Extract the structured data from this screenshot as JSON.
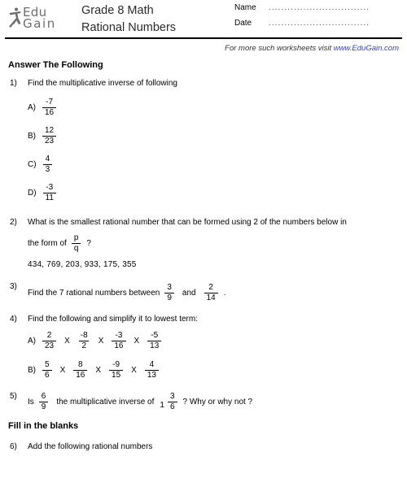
{
  "header": {
    "logo": {
      "icon": "running-figure-icon",
      "line1": "Edu",
      "line2": "Gain"
    },
    "title_line1": "Grade 8 Math",
    "title_line2": "Rational Numbers",
    "name_label": "Name",
    "date_label": "Date",
    "name_value": "",
    "date_value": "",
    "dots": "................................"
  },
  "promo": {
    "text": "For more such worksheets visit ",
    "link": "www.EduGain.com",
    "link_color": "#2c3fd6"
  },
  "sections": [
    {
      "heading": "Answer The Following"
    },
    {
      "heading": "Fill in the blanks"
    }
  ],
  "questions": {
    "q1": {
      "number": "1)",
      "text": "Find the multiplicative inverse of following",
      "options": [
        {
          "label": "A)",
          "num": "-7",
          "den": "16"
        },
        {
          "label": "B)",
          "num": "12",
          "den": "23"
        },
        {
          "label": "C)",
          "num": "4",
          "den": "3"
        },
        {
          "label": "D)",
          "num": "-3",
          "den": "11"
        }
      ]
    },
    "q2": {
      "number": "2)",
      "line1": "What is the smallest rational number that can be formed using 2 of the numbers below in",
      "line2_lead": "the form of",
      "frac_num": "p",
      "frac_den": "q",
      "line2_tail": "?",
      "numbers": "434, 769, 203, 933, 175, 355"
    },
    "q3": {
      "number": "3)",
      "lead": "Find the 7 rational numbers between",
      "frac1_num": "3",
      "frac1_den": "9",
      "mid": "and",
      "frac2_num": "2",
      "frac2_den": "14",
      "tail": "."
    },
    "q4": {
      "number": "4)",
      "text": "Find the following and simplify it to lowest term:",
      "operator": "X",
      "options": [
        {
          "label": "A)",
          "fractions": [
            {
              "num": "2",
              "den": "23"
            },
            {
              "num": "-8",
              "den": "2"
            },
            {
              "num": "-3",
              "den": "16"
            },
            {
              "num": "-5",
              "den": "13"
            }
          ]
        },
        {
          "label": "B)",
          "fractions": [
            {
              "num": "5",
              "den": "6"
            },
            {
              "num": "8",
              "den": "16"
            },
            {
              "num": "-9",
              "den": "15"
            },
            {
              "num": "4",
              "den": "13"
            }
          ]
        }
      ]
    },
    "q5": {
      "number": "5)",
      "lead": "Is",
      "frac1_num": "6",
      "frac1_den": "9",
      "mid": "the multiplicative inverse of",
      "mixed_whole": "1",
      "mixed_num": "3",
      "mixed_den": "6",
      "tail": "? Why or why not ?"
    },
    "q6": {
      "number": "6)",
      "text": "Add the following rational numbers"
    }
  }
}
